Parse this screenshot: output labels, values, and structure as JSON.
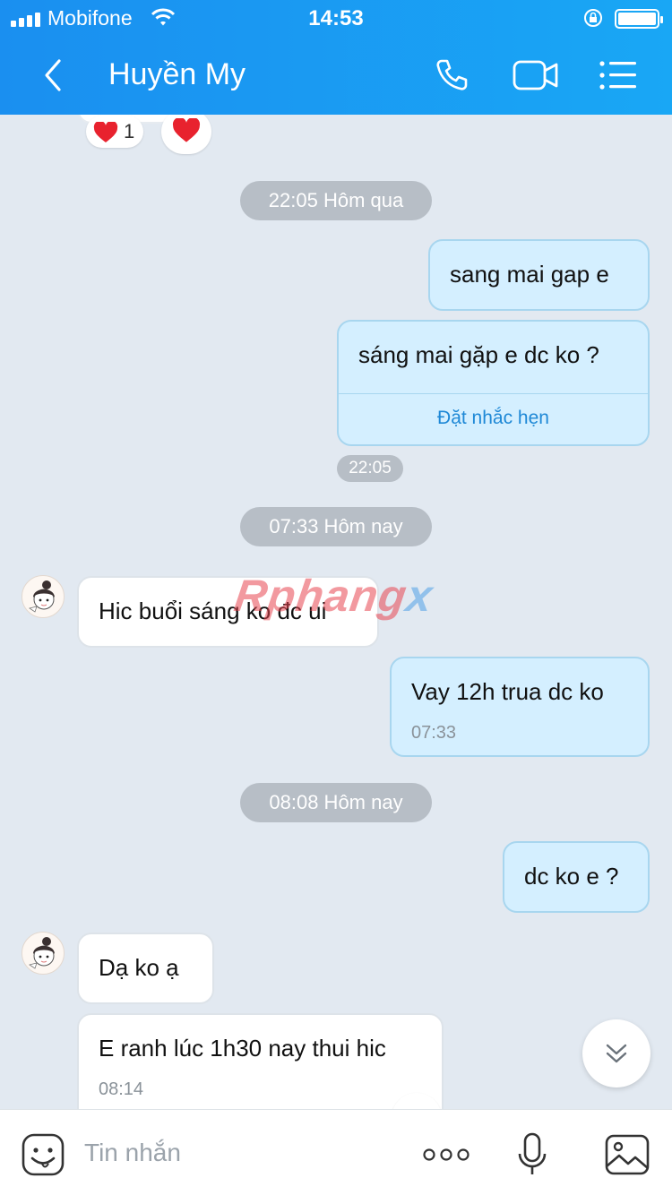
{
  "status": {
    "carrier": "Mobifone",
    "time": "14:53"
  },
  "header": {
    "title": "Huyền My"
  },
  "reactions": {
    "heart_count": "1"
  },
  "messages": {
    "sep1": "22:05 Hôm qua",
    "m1": "sang mai gap e",
    "m2": "sáng mai gặp e dc ko ?",
    "m2_action": "Đặt nhắc hẹn",
    "m2_time": "22:05",
    "sep2": "07:33 Hôm nay",
    "r1": "Hic buổi sáng ko đc ui",
    "m3": "Vay 12h trua dc ko",
    "m3_time": "07:33",
    "sep3": "08:08 Hôm nay",
    "m4": "dc ko e ?",
    "r2": "Dạ ko ạ",
    "r3": "E ranh lúc 1h30 nay thui hic",
    "r3_time": "08:14"
  },
  "watermark": {
    "part1": "Rphang",
    "part2": "x"
  },
  "input": {
    "placeholder": "Tin nhắn"
  },
  "colors": {
    "header": "#1a8ff0",
    "mine_bubble": "#d4efff",
    "theirs_bubble": "#ffffff",
    "background": "#e2e9f1"
  }
}
